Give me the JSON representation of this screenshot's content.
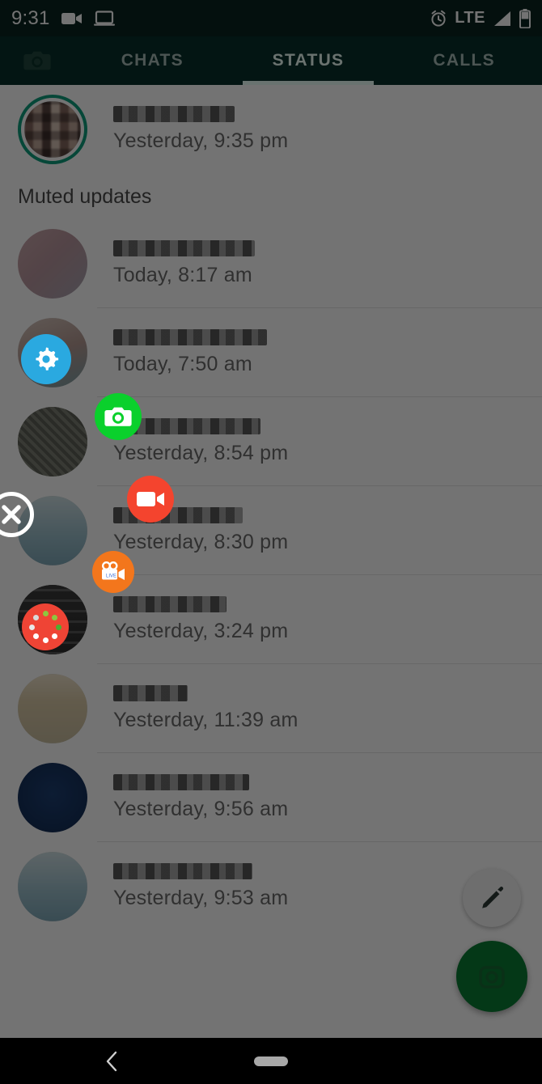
{
  "status_bar": {
    "time": "9:31",
    "icons_left": [
      "video-camera-icon",
      "laptop-icon"
    ],
    "network": "LTE",
    "icons_right": [
      "alarm-icon",
      "signal-icon",
      "battery-icon"
    ],
    "background": "#0a241f"
  },
  "tabs": {
    "camera_icon": "camera-icon",
    "items": [
      {
        "label": "CHATS",
        "active": false
      },
      {
        "label": "STATUS",
        "active": true
      },
      {
        "label": "CALLS",
        "active": false
      }
    ],
    "background": "#07302a",
    "active_color": "#eafcf7",
    "inactive_color": "#a9bdb9"
  },
  "status_list": {
    "recent": [
      {
        "name": "",
        "time": "Yesterday, 9:35 pm",
        "unviewed": true,
        "ring_color": "#0f9d7d"
      }
    ],
    "muted_header": "Muted updates",
    "muted": [
      {
        "name": "",
        "time": "Today, 8:17 am"
      },
      {
        "name": "",
        "time": "Today, 7:50 am"
      },
      {
        "name": "",
        "time": "Yesterday, 8:54 pm"
      },
      {
        "name": "",
        "time": "Yesterday, 8:30 pm"
      },
      {
        "name": "",
        "time": "Yesterday, 3:24 pm"
      },
      {
        "name": "",
        "time": "Yesterday, 11:39 am"
      },
      {
        "name": "",
        "time": "Yesterday, 9:56 am"
      },
      {
        "name": "",
        "time": "Yesterday, 9:53 am"
      }
    ]
  },
  "fabs": {
    "edit": {
      "icon": "pencil-icon",
      "color": "#f3f3f3"
    },
    "camera": {
      "icon": "camera-icon",
      "color": "#0a7c34"
    }
  },
  "overlay": {
    "scrim_color": "rgba(0,0,0,0.55)",
    "close": {
      "icon": "close-icon",
      "color": "#ffffff"
    },
    "items": [
      {
        "icon": "gear-icon",
        "color": "#2aa9e0"
      },
      {
        "icon": "camera-icon",
        "color": "#0ad02c"
      },
      {
        "icon": "video-camera-icon",
        "color": "#f4442e"
      },
      {
        "icon": "movie-camera-icon",
        "color": "#f3761c"
      },
      {
        "icon": "loading-dots-icon",
        "color": "#ef4435"
      }
    ]
  },
  "nav_bar": {
    "back_icon": "back-chevron-icon",
    "home_indicator": "home-pill-indicator",
    "background": "#000000"
  }
}
